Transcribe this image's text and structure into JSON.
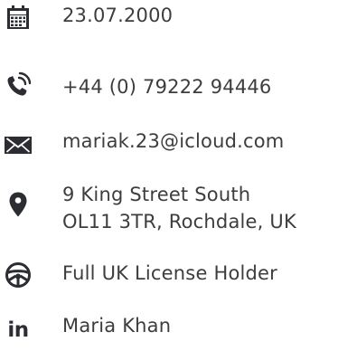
{
  "contact": {
    "birth_date": "23.07.2000",
    "phone": "+44 (0) 79222 94446",
    "email": "mariak.23@icloud.com",
    "address_line1": "9 King Street South",
    "address_line2": "OL11 3TR, Rochdale, UK",
    "license": "Full UK License Holder",
    "linkedin": "Maria Khan",
    "linkedin_glyph": "in"
  },
  "icons": {
    "birth_date": "calendar-icon",
    "phone": "phone-icon",
    "email": "envelope-icon",
    "address": "map-pin-icon",
    "license": "steering-wheel-icon",
    "linkedin": "linkedin-icon"
  },
  "colors": {
    "icon": "#2b2d33",
    "text": "#3d3d3d",
    "background": "#ffffff"
  }
}
